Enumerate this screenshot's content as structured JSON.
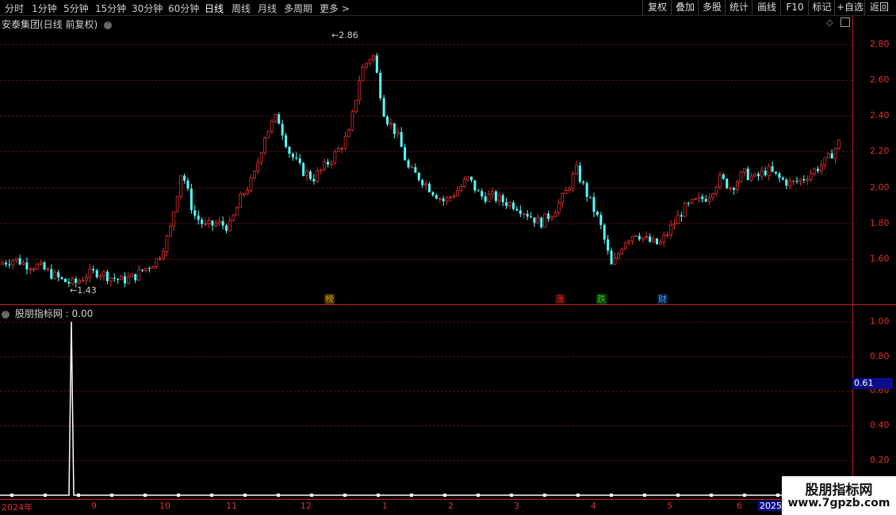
{
  "toolbar": {
    "periods": [
      "分时",
      "1分钟",
      "5分钟",
      "15分钟",
      "30分钟",
      "60分钟",
      "日线",
      "周线",
      "月线",
      "多周期",
      "更多 >"
    ],
    "active_period": "日线",
    "right_buttons": [
      "复权",
      "叠加",
      "多股",
      "统计",
      "画线",
      "F10",
      "标记",
      "+自选",
      "返回"
    ]
  },
  "main_panel": {
    "title": "安泰集团(日线 前复权)",
    "high_label": "2.86",
    "low_label": "1.43",
    "price_ticks": [
      "2.80",
      "2.60",
      "2.40",
      "2.20",
      "2.00",
      "1.80",
      "1.60"
    ],
    "markers": [
      {
        "text": "榜",
        "color": "#e0a000"
      },
      {
        "text": "涨",
        "color": "#e03030"
      },
      {
        "text": "跌",
        "color": "#30c030"
      },
      {
        "text": "财",
        "color": "#40a0ff"
      }
    ],
    "colors": {
      "up": "#e03030",
      "down": "#54ffff",
      "grid": "#5a1010"
    }
  },
  "indicator_panel": {
    "label": "股朋指标网",
    "value": ": 0.00",
    "ticks": [
      "1.00",
      "0.80",
      "0.60",
      "0.40",
      "0.20"
    ],
    "current_value": "0.61"
  },
  "date_axis": {
    "labels": [
      "2024年",
      "9",
      "10",
      "11",
      "12",
      "1",
      "2",
      "3",
      "4",
      "5",
      "6",
      "2025"
    ]
  },
  "watermark": {
    "title": "股朋指标网",
    "url": "www.7gpzb.com"
  },
  "chart_data": {
    "type": "candlestick",
    "title": "安泰集团(日线 前复权)",
    "y_range": [
      1.43,
      2.86
    ],
    "y_ticks": [
      1.6,
      1.8,
      2.0,
      2.2,
      2.4,
      2.6,
      2.8
    ],
    "annotated_high": 2.86,
    "annotated_low": 1.43,
    "x_months": [
      "2024年",
      "9",
      "10",
      "11",
      "12",
      "1",
      "2",
      "3",
      "4",
      "5",
      "6",
      "2025"
    ],
    "close_path": [
      1.58,
      1.6,
      1.57,
      1.56,
      1.52,
      1.48,
      1.46,
      1.51,
      1.53,
      1.5,
      1.48,
      1.5,
      1.55,
      1.6,
      1.75,
      2.1,
      1.85,
      1.78,
      1.8,
      1.78,
      1.95,
      2.05,
      2.3,
      2.4,
      2.2,
      2.1,
      2.05,
      2.12,
      2.2,
      2.3,
      2.65,
      2.75,
      2.4,
      2.3,
      2.1,
      2.05,
      1.98,
      1.92,
      1.98,
      2.05,
      1.95,
      1.95,
      1.92,
      1.9,
      1.85,
      1.8,
      1.86,
      1.95,
      2.1,
      1.95,
      1.8,
      1.55,
      1.7,
      1.75,
      1.7,
      1.68,
      1.78,
      1.88,
      1.92,
      1.95,
      2.05,
      2.0,
      2.08,
      2.05,
      2.1,
      2.05,
      2.02,
      2.05,
      2.1,
      2.15,
      2.25
    ],
    "indicator": {
      "name": "股朋指标网",
      "value": 0.0,
      "y_range": [
        0,
        1.0
      ],
      "y_ticks": [
        0.2,
        0.4,
        0.6,
        0.8,
        1.0
      ],
      "spike_value": 1.0,
      "spike_month": "8",
      "current_readout": 0.61
    }
  }
}
